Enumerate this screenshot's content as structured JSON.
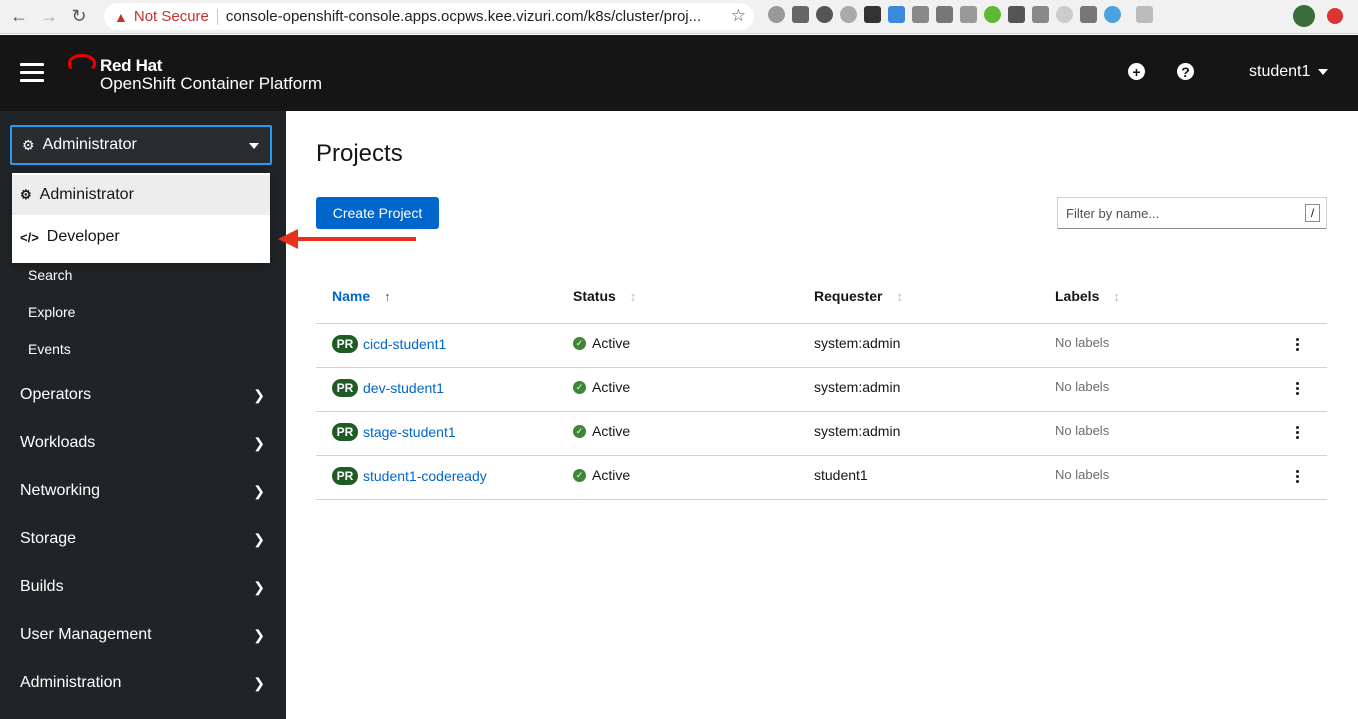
{
  "browser": {
    "not_secure": "Not Secure",
    "url": "console-openshift-console.apps.ocpws.kee.vizuri.com/k8s/cluster/proj..."
  },
  "masthead": {
    "brand_line1": "Red Hat",
    "brand_line2": "OpenShift Container Platform",
    "user": "student1"
  },
  "perspective": {
    "selected": "Administrator",
    "options": [
      "Administrator",
      "Developer"
    ]
  },
  "sidebar": {
    "home_subitems": [
      "Search",
      "Explore",
      "Events"
    ],
    "sections": [
      "Operators",
      "Workloads",
      "Networking",
      "Storage",
      "Builds",
      "User Management",
      "Administration"
    ]
  },
  "main": {
    "title": "Projects",
    "create_label": "Create Project",
    "filter_placeholder": "Filter by name...",
    "filter_shortcut": "/",
    "columns": [
      "Name",
      "Status",
      "Requester",
      "Labels"
    ],
    "rows": [
      {
        "badge": "PR",
        "name": "cicd-student1",
        "status": "Active",
        "requester": "system:admin",
        "labels": "No labels"
      },
      {
        "badge": "PR",
        "name": "dev-student1",
        "status": "Active",
        "requester": "system:admin",
        "labels": "No labels"
      },
      {
        "badge": "PR",
        "name": "stage-student1",
        "status": "Active",
        "requester": "system:admin",
        "labels": "No labels"
      },
      {
        "badge": "PR",
        "name": "student1-codeready",
        "status": "Active",
        "requester": "student1",
        "labels": "No labels"
      }
    ]
  },
  "colors": {
    "accent": "#0066cc",
    "sidebar": "#212427",
    "masthead": "#151515",
    "project_badge": "#1f5b25",
    "status_ok": "#3e8635",
    "annotation_arrow": "#e8311c"
  }
}
